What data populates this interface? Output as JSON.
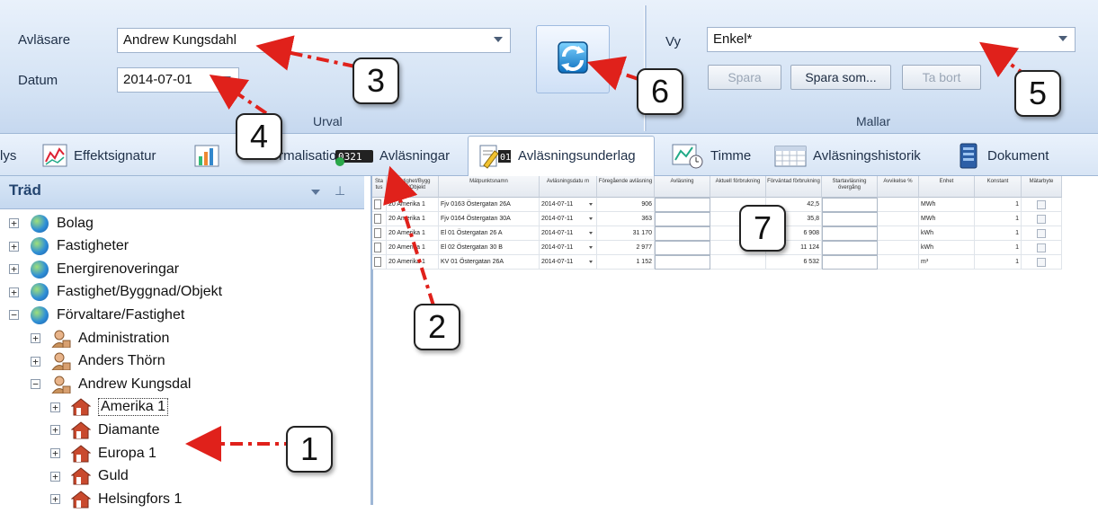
{
  "ribbon": {
    "reader_label": "Avläsare",
    "reader_value": "Andrew Kungsdahl",
    "date_label": "Datum",
    "date_value": "2014-07-01",
    "group_urval": "Urval",
    "view_label": "Vy",
    "view_value": "Enkel*",
    "save_label": "Spara",
    "save_as_label": "Spara som...",
    "delete_label": "Ta bort",
    "group_mallar": "Mallar"
  },
  "tabs": [
    {
      "label": "lys"
    },
    {
      "label": "Effektsignatur"
    },
    {
      "label": "Normalisation"
    },
    {
      "label": "Avläsningar"
    },
    {
      "label": "Avläsningsunderlag"
    },
    {
      "label": "Timme"
    },
    {
      "label": "Avläsningshistorik"
    },
    {
      "label": "Dokument"
    }
  ],
  "tree": {
    "title": "Träd",
    "items": [
      {
        "label": "Bolag",
        "toggle": "+"
      },
      {
        "label": "Fastigheter",
        "toggle": "+"
      },
      {
        "label": "Energirenoveringar",
        "toggle": "+"
      },
      {
        "label": "Fastighet/Byggnad/Objekt",
        "toggle": "+"
      },
      {
        "label": "Förvaltare/Fastighet",
        "toggle": "−"
      },
      {
        "label": "Administration",
        "toggle": "+"
      },
      {
        "label": "Anders Thörn",
        "toggle": "+"
      },
      {
        "label": "Andrew Kungsdal",
        "toggle": "−"
      },
      {
        "label": "Amerika 1",
        "toggle": "+"
      },
      {
        "label": "Diamante",
        "toggle": "+"
      },
      {
        "label": "Europa 1",
        "toggle": "+"
      },
      {
        "label": "Guld",
        "toggle": "+"
      },
      {
        "label": "Helsingfors 1",
        "toggle": "+"
      }
    ]
  },
  "grid": {
    "columns": [
      "Sta tus",
      "Fastighet/Bygg nad/Objekt",
      "Mätpunktsnamn",
      "Avläsningsdatu m",
      "Föregående avläsning",
      "Avläsning",
      "Aktuell förbrukning",
      "Förväntad förbrukning",
      "Startavläsning övergång",
      "Avvikelse %",
      "Enhet",
      "Konstant",
      "Mätarbyte"
    ],
    "rows": [
      {
        "obj": "20 Amerika 1",
        "name": "Fjv 0163 Östergatan 26A",
        "date": "2014-07-11",
        "prev": "906",
        "exp": "42,5",
        "unit": "MWh",
        "k": "1"
      },
      {
        "obj": "20 Amerika 1",
        "name": "Fjv 0164 Östergatan 30A",
        "date": "2014-07-11",
        "prev": "363",
        "exp": "35,8",
        "unit": "MWh",
        "k": "1"
      },
      {
        "obj": "20 Amerika 1",
        "name": "El 01 Östergatan 26 A",
        "date": "2014-07-11",
        "prev": "31 170",
        "exp": "6 908",
        "unit": "kWh",
        "k": "1"
      },
      {
        "obj": "20 Amerika 1",
        "name": "El 02 Östergatan 30 B",
        "date": "2014-07-11",
        "prev": "2 977",
        "exp": "11 124",
        "unit": "kWh",
        "k": "1"
      },
      {
        "obj": "20 Amerika 1",
        "name": "KV 01 Östergatan 26A",
        "date": "2014-07-11",
        "prev": "1 152",
        "exp": "6 532",
        "unit": "m³",
        "k": "1"
      }
    ]
  },
  "callouts": [
    "1",
    "2",
    "3",
    "4",
    "5",
    "6",
    "7"
  ],
  "colors": {
    "arrow": "#e0211b",
    "accent": "#24456f"
  }
}
